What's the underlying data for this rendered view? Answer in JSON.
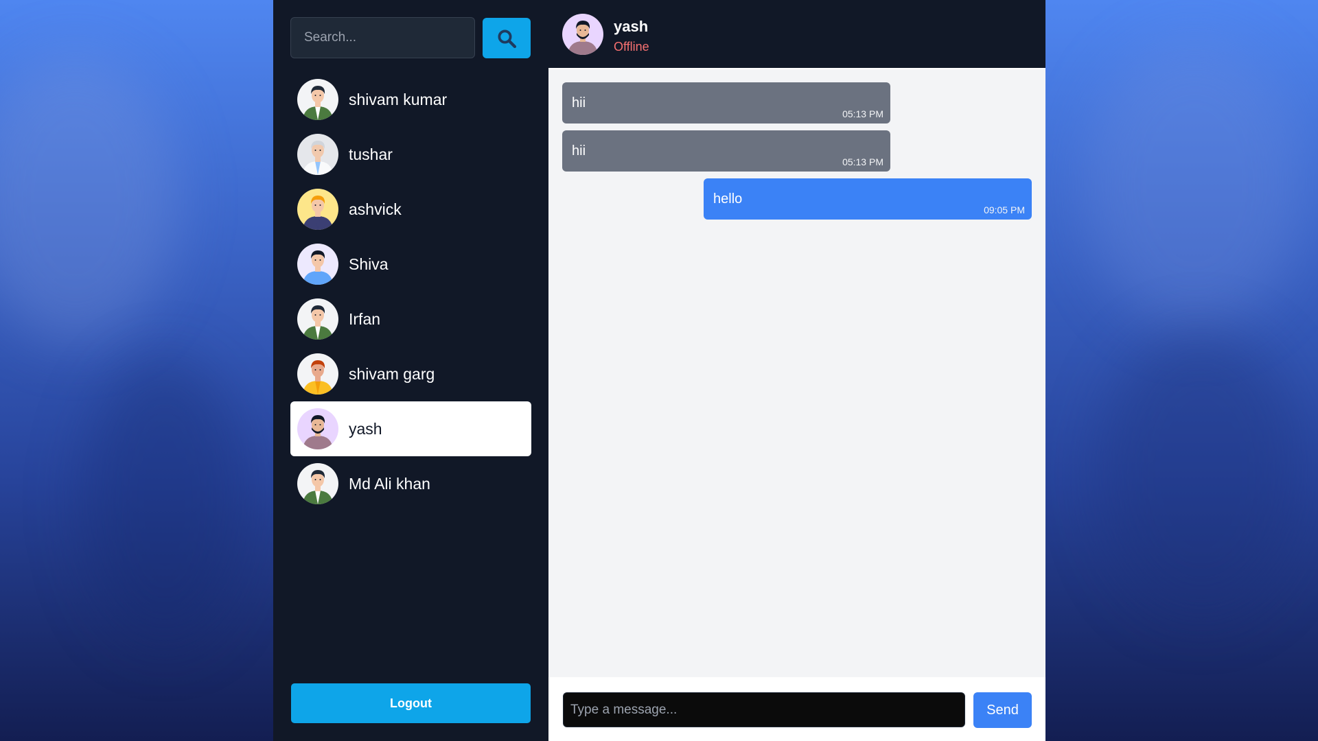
{
  "colors": {
    "sidebar_bg": "#111827",
    "accent": "#0ea5e9",
    "outgoing_bubble": "#3b82f6",
    "incoming_bubble": "#6b7280",
    "offline_status": "#f87171"
  },
  "sidebar": {
    "search": {
      "placeholder": "Search...",
      "value": "",
      "button_icon": "search-icon"
    },
    "contacts": [
      {
        "name": "shivam kumar",
        "avatar": "avatar-green-jacket",
        "active": false
      },
      {
        "name": "tushar",
        "avatar": "avatar-white-shirt",
        "active": false
      },
      {
        "name": "ashvick",
        "avatar": "avatar-yellow-hair",
        "active": false
      },
      {
        "name": "Shiva",
        "avatar": "avatar-blue-shirt",
        "active": false
      },
      {
        "name": "Irfan",
        "avatar": "avatar-green-jacket",
        "active": false
      },
      {
        "name": "shivam garg",
        "avatar": "avatar-yellow-shirt",
        "active": false
      },
      {
        "name": "yash",
        "avatar": "avatar-beard",
        "active": true
      },
      {
        "name": "Md Ali khan",
        "avatar": "avatar-green-jacket",
        "active": false
      }
    ],
    "logout_label": "Logout"
  },
  "chat": {
    "header": {
      "name": "yash",
      "status": "Offline",
      "avatar": "avatar-beard"
    },
    "messages": [
      {
        "text": "hii",
        "time": "05:13 PM",
        "direction": "incoming"
      },
      {
        "text": "hii",
        "time": "05:13 PM",
        "direction": "incoming"
      },
      {
        "text": "hello",
        "time": "09:05 PM",
        "direction": "outgoing"
      }
    ],
    "composer": {
      "placeholder": "Type a message...",
      "value": "",
      "send_label": "Send"
    }
  }
}
